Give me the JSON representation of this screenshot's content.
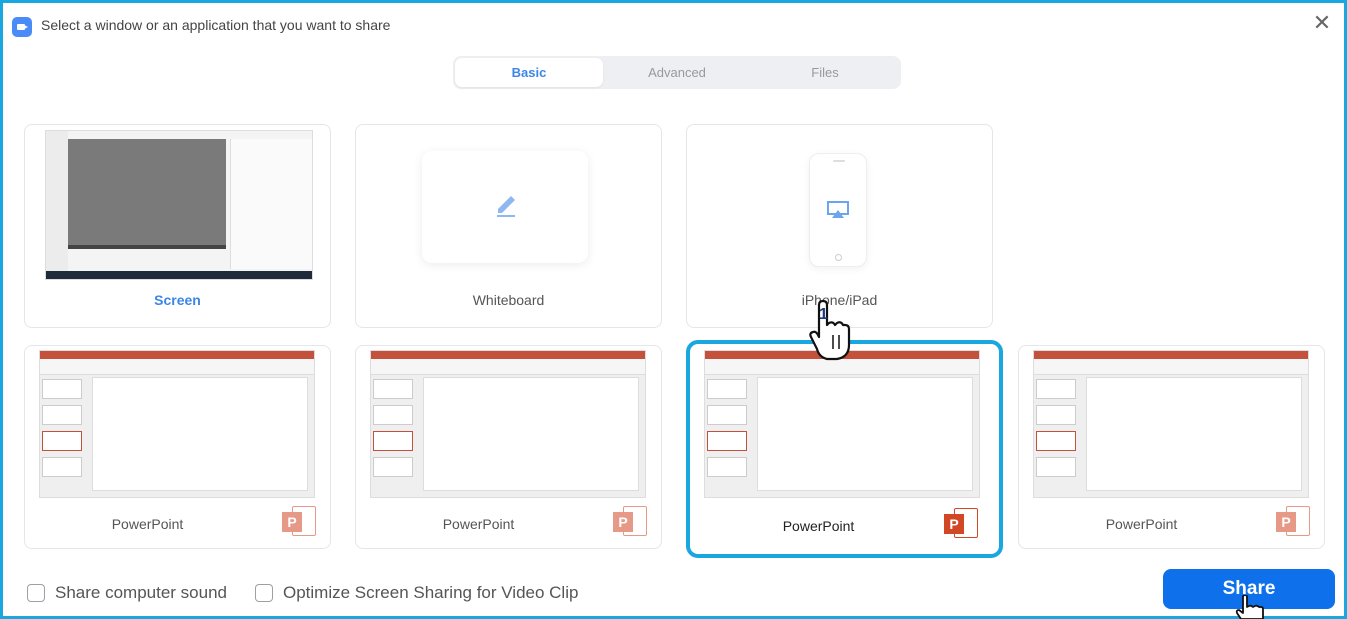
{
  "window": {
    "title": "Select a window or an application that you want to share",
    "close_glyph": "✕"
  },
  "tabs": [
    {
      "label": "Basic",
      "active": true
    },
    {
      "label": "Advanced",
      "active": false
    },
    {
      "label": "Files",
      "active": false
    }
  ],
  "sources": {
    "screen": {
      "label": "Screen"
    },
    "whiteboard": {
      "label": "Whiteboard"
    },
    "iphone": {
      "label": "iPhone/iPad"
    },
    "windows": [
      {
        "label": "PowerPoint",
        "selected": false
      },
      {
        "label": "PowerPoint",
        "selected": false
      },
      {
        "label": "PowerPoint",
        "selected": true
      },
      {
        "label": "PowerPoint",
        "selected": false
      }
    ]
  },
  "options": {
    "share_sound": {
      "label": "Share computer sound",
      "checked": false
    },
    "optimize_video": {
      "label": "Optimize Screen Sharing for Video Clip",
      "checked": false
    }
  },
  "share_button": {
    "label": "Share"
  },
  "annotation": {
    "step": "1"
  },
  "icons": {
    "powerpoint_letter": "P"
  },
  "colors": {
    "accent": "#1aa7e0",
    "primary": "#0e71eb",
    "tab_active": "#3d86e8",
    "powerpoint": "#d24726"
  }
}
